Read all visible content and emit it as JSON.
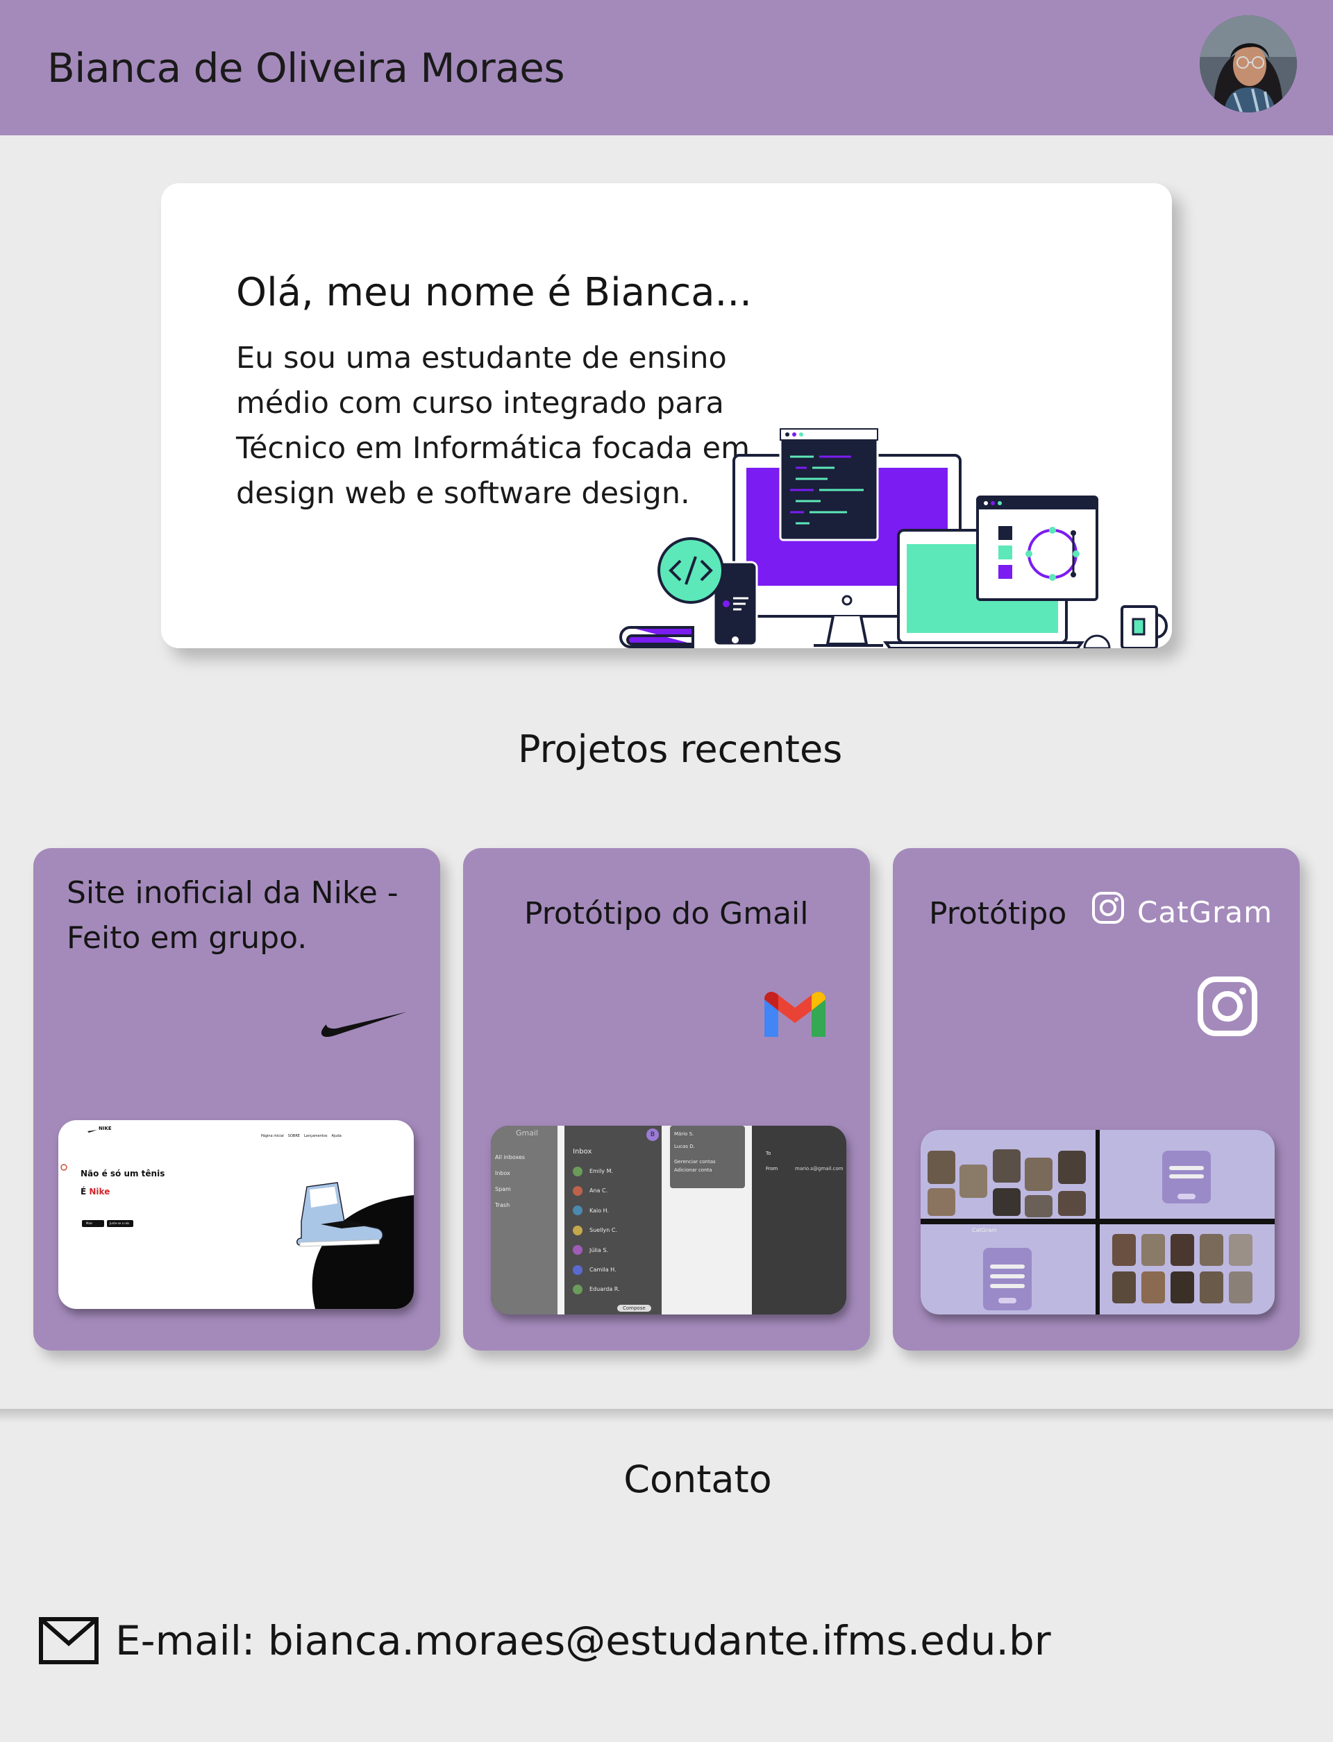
{
  "header": {
    "name": "Bianca de Oliveira Moraes",
    "avatar_alt": "profile photo"
  },
  "hero": {
    "heading": "Olá, meu nome é Bianca...",
    "text": "Eu sou uma estudante de ensino médio com curso integrado para Técnico em Informática focada em design web e software design."
  },
  "projects": {
    "title": "Projetos recentes",
    "items": [
      {
        "title": "Site inoficial da Nike - Feito em grupo.",
        "icon": "nike-swoosh-icon",
        "preview": {
          "brand": "NIKE",
          "nav": [
            "Página inicial",
            "SOBRE",
            "Lançamentos",
            "Ajuda"
          ],
          "headline": "Não é só um tênis",
          "brand_line_prefix": "É ",
          "brand_line_accent": "Nike",
          "button1": "Mais",
          "button2": "Junte-se a nós"
        }
      },
      {
        "title": "Protótipo do Gmail",
        "icon": "gmail-icon",
        "preview": {
          "app": "Gmail",
          "folders": [
            "All inboxes",
            "Inbox",
            "Spam",
            "Trash"
          ],
          "list_title": "Inbox",
          "contacts": [
            "Emily M.",
            "Ana C.",
            "Kaio H.",
            "Suellyn C.",
            "Júlia S.",
            "Camila H.",
            "Eduarda R."
          ],
          "account_menu": [
            "Mário S.",
            "Lucas D.",
            "Gerenciar contas",
            "Adicionar conta"
          ],
          "compose_to": "To",
          "compose_from": "From",
          "compose_from_value": "mario.s@gmail.com",
          "compose_button": "Compose",
          "avatar_initial": "B"
        }
      },
      {
        "title_prefix": "Protótipo",
        "title_brand": "CatGram",
        "icon": "instagram-icon",
        "preview": {
          "app": "CatGram"
        }
      }
    ]
  },
  "contact": {
    "title": "Contato",
    "email_label": "E-mail: bianca.moraes@estudante.ifms.edu.br"
  },
  "colors": {
    "accent": "#a48abb",
    "background": "#ebebeb",
    "hero_purple": "#7b1cf2",
    "hero_green": "#5ce8b8",
    "navy": "#1a1f3a"
  }
}
